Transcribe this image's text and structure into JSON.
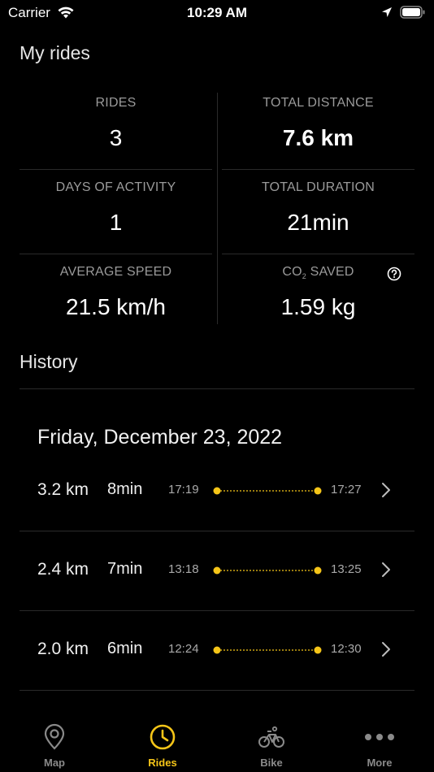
{
  "status_bar": {
    "carrier": "Carrier",
    "time": "10:29 AM"
  },
  "title": "My rides",
  "stats": {
    "rides": {
      "label": "RIDES",
      "value": "3"
    },
    "total_distance": {
      "label": "TOTAL DISTANCE",
      "value": "7.6 km"
    },
    "days_of_activity": {
      "label": "DAYS OF ACTIVITY",
      "value": "1"
    },
    "total_duration": {
      "label": "TOTAL DURATION",
      "value": "21min"
    },
    "average_speed": {
      "label": "AVERAGE SPEED",
      "value": "21.5 km/h"
    },
    "co2_saved": {
      "label_prefix": "CO",
      "label_sub": "2",
      "label_suffix": " SAVED",
      "value": "1.59 kg"
    }
  },
  "history": {
    "title": "History",
    "date": "Friday, December 23, 2022",
    "rides": [
      {
        "distance": "3.2 km",
        "duration": "8min",
        "start": "17:19",
        "end": "17:27"
      },
      {
        "distance": "2.4 km",
        "duration": "7min",
        "start": "13:18",
        "end": "13:25"
      },
      {
        "distance": "2.0 km",
        "duration": "6min",
        "start": "12:24",
        "end": "12:30"
      }
    ]
  },
  "tabs": [
    {
      "label": "Map",
      "icon": "map-pin-icon",
      "active": false
    },
    {
      "label": "Rides",
      "icon": "clock-icon",
      "active": true
    },
    {
      "label": "Bike",
      "icon": "bike-icon",
      "active": false
    },
    {
      "label": "More",
      "icon": "more-icon",
      "active": false
    }
  ],
  "colors": {
    "accent": "#f5c518",
    "background": "#000000",
    "label": "#9a9a9a"
  }
}
